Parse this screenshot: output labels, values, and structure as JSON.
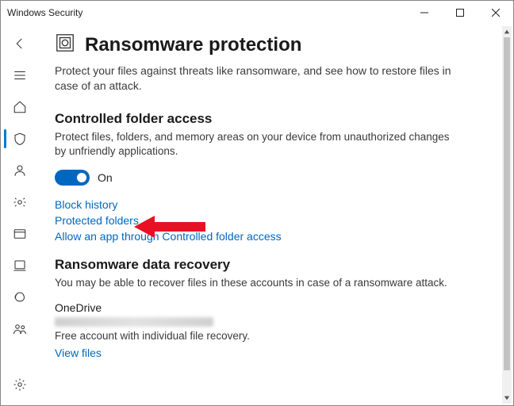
{
  "window": {
    "title": "Windows Security"
  },
  "header": {
    "title": "Ransomware protection",
    "description": "Protect your files against threats like ransomware, and see how to restore files in case of an attack."
  },
  "controlled_folder_access": {
    "heading": "Controlled folder access",
    "description": "Protect files, folders, and memory areas on your device from unauthorized changes by unfriendly applications.",
    "toggle_state": "On",
    "links": {
      "block_history": "Block history",
      "protected_folders": "Protected folders",
      "allow_app": "Allow an app through Controlled folder access"
    }
  },
  "data_recovery": {
    "heading": "Ransomware data recovery",
    "description": "You may be able to recover files in these accounts in case of a ransomware attack.",
    "onedrive": {
      "name": "OneDrive",
      "note": "Free account with individual file recovery.",
      "view_files": "View files"
    }
  },
  "sidebar": {
    "items": [
      "back",
      "menu",
      "home",
      "virus",
      "account",
      "firewall",
      "app",
      "device",
      "health",
      "family"
    ],
    "bottom": "settings",
    "active": "virus"
  }
}
